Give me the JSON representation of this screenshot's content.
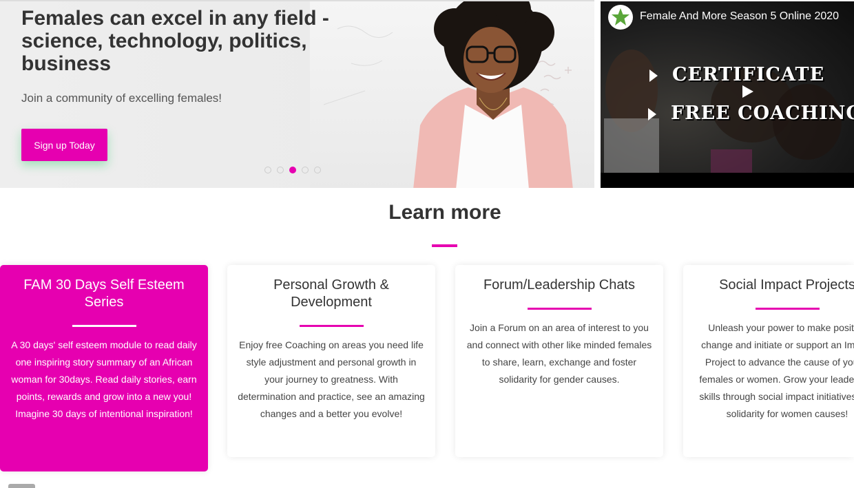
{
  "hero": {
    "title": "Females can excel in any field - science, technology, politics, business",
    "subtitle": "Join a community of excelling females!",
    "cta_label": "Sign up Today",
    "carousel_active_index": 2,
    "carousel_count": 5,
    "accent_color": "#e600b0"
  },
  "video": {
    "title": "Female And More Season 5 Online 2020",
    "overlay_line1": "CERTIFICATE",
    "overlay_line2": "FREE COACHING",
    "channel_icon": "star-logo-icon",
    "play_icon": "play-icon"
  },
  "learn_more": {
    "heading": "Learn more",
    "cards": [
      {
        "title": "FAM 30 Days Self Esteem Series",
        "text": "A 30 days' self esteem module to read daily one inspiring story summary of an African woman for 30days. Read daily stories, earn points, rewards and grow into a new you! Imagine 30 days of intentional inspiration!"
      },
      {
        "title": "Personal Growth & Development",
        "text": "Enjoy free Coaching on areas you need life style adjustment and personal growth in your journey to greatness. With determination and practice, see an amazing changes and a better you evolve!"
      },
      {
        "title": "Forum/Leadership Chats",
        "text": "Join a Forum on an area of interest to you and connect with other like minded females to share, learn, exchange and foster solidarity for gender causes."
      },
      {
        "title": "Social Impact Projects",
        "text": "Unleash your power to make positive change and initiate or support an Impact Project to advance the cause of young females or women. Grow your leadership skills through social impact initiatives and solidarity for women causes!"
      }
    ]
  }
}
